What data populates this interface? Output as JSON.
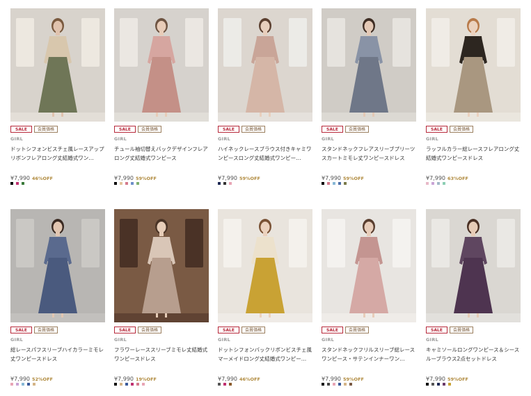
{
  "products": [
    {
      "sale": "SALE",
      "member": "会員価格",
      "brand": "GIRL",
      "title": "ドットシフォンビスチェ風レースアップリボンフレアロング丈結婚式ワン…",
      "price": "¥7,990",
      "discount": "46%OFF",
      "swatches": [
        "#000000",
        "#c0306f",
        "#3a7a3a"
      ],
      "photo": {
        "bg": "#d8d3cc",
        "window": "#ede8e0",
        "dress": "#6f7657",
        "accent": "#d8c7ad",
        "skin": "#e0c3ae",
        "hair": "#7a5a3f"
      }
    },
    {
      "sale": "SALE",
      "member": "会員価格",
      "brand": "GIRL",
      "title": "チュール袖切替えバックデザインフレアロング丈結婚式ワンピース",
      "price": "¥7,990",
      "discount": "59%OFF",
      "swatches": [
        "#000000",
        "#e2c49d",
        "#d47a8c",
        "#6e8fc9",
        "#80b070"
      ],
      "photo": {
        "bg": "#d6d2cd",
        "window": "#ebe7e2",
        "dress": "#c49087",
        "accent": "#d6a6a0",
        "skin": "#e8ccb8",
        "hair": "#6e5442"
      }
    },
    {
      "sale": "SALE",
      "member": "会員価格",
      "brand": "GIRL",
      "title": "ハイネックレースブラウス付きキャミワンピースロング丈結婚式ワンピー…",
      "price": "¥7,990",
      "discount": "59%OFF",
      "swatches": [
        "#1f2a55",
        "#333333",
        "#e8a5b5"
      ],
      "photo": {
        "bg": "#dcd6cf",
        "window": "#ecebe7",
        "dress": "#d5b6a7",
        "accent": "#c9a598",
        "skin": "#e8cfbd",
        "hair": "#5c4030"
      }
    },
    {
      "sale": "SALE",
      "member": "会員価格",
      "brand": "GIRL",
      "title": "スタンドネックフレアスリーブプリーツスカートミモレ丈ワンピースドレス",
      "price": "¥7,990",
      "discount": "59%OFF",
      "swatches": [
        "#000000",
        "#d47a8c",
        "#88b8d6",
        "#4d6fa8",
        "#7a7a4a"
      ],
      "photo": {
        "bg": "#d0ccc6",
        "window": "#e6e3de",
        "dress": "#6f7788",
        "accent": "#8993a6",
        "skin": "#e4c9b6",
        "hair": "#3f2e24"
      }
    },
    {
      "sale": "SALE",
      "member": "会員価格",
      "brand": "GIRL",
      "title": "ラッフルカラー総レースフレアロング丈結婚式ワンピースドレス",
      "price": "¥7,990",
      "discount": "63%OFF",
      "swatches": [
        "#e8b9c8",
        "#c9a4d6",
        "#a2b8c7",
        "#8dcfb4"
      ],
      "photo": {
        "bg": "#e3ddd4",
        "window": "#f0ece6",
        "dress": "#a99780",
        "accent": "#2d2620",
        "skin": "#ebd2bf",
        "hair": "#b87a4a"
      }
    },
    {
      "sale": "SALE",
      "member": "会員価格",
      "brand": "GIRL",
      "title": "総レースパフスリーブハイカラーミモレ丈ワンピースドレス",
      "price": "¥7,990",
      "discount": "52%OFF",
      "swatches": [
        "#e8a5b5",
        "#c9a4d6",
        "#88b8d6",
        "#3a5a9a",
        "#d4b487"
      ],
      "photo": {
        "bg": "#b8b6b3",
        "window": "#cac8c4",
        "dress": "#4a5a7e",
        "accent": "#5a6a8e",
        "skin": "#e2c6b1",
        "hair": "#3a2a22"
      }
    },
    {
      "sale": "SALE",
      "member": "会員価格",
      "brand": "GIRL",
      "title": "フラワーレーススリーブミモレ丈結婚式ワンピースドレス",
      "price": "¥7,990",
      "discount": "19%OFF",
      "swatches": [
        "#000000",
        "#d4b487",
        "#3a5a9a",
        "#c0306f",
        "#d47a8c",
        "#e8a5b5"
      ],
      "photo": {
        "bg": "#7a5a44",
        "window": "#4a3226",
        "dress": "#b79e8e",
        "accent": "#d9c6b7",
        "skin": "#e7cdb8",
        "hair": "#4a3426"
      }
    },
    {
      "sale": "SALE",
      "member": "会員価格",
      "brand": "GIRL",
      "title": "ドットシフォンバックリボンビスチェ風マーメイドロング丈結婚式ワンピー…",
      "price": "¥7,990",
      "discount": "46%OFF",
      "swatches": [
        "#555555",
        "#c0306f",
        "#8a5a2a"
      ],
      "photo": {
        "bg": "#e9e4dd",
        "window": "#f4f1ec",
        "dress": "#c9a234",
        "accent": "#ece1cc",
        "skin": "#ebd2be",
        "hair": "#7a5235"
      }
    },
    {
      "sale": "SALE",
      "member": "会員価格",
      "brand": "GIRL",
      "title": "スタンドネックフリルスリーブ総レースワンピース・サテンインナーワン…",
      "price": "¥7,990",
      "discount": "59%OFF",
      "swatches": [
        "#000000",
        "#444444",
        "#e8a5b5",
        "#3a5a9a",
        "#d4b487",
        "#7a5a44"
      ],
      "photo": {
        "bg": "#e8e5e1",
        "window": "#f4f2ef",
        "dress": "#d5a9a5",
        "accent": "#c49591",
        "skin": "#e8cdba",
        "hair": "#5a3f30"
      }
    },
    {
      "sale": "SALE",
      "member": "会員価格",
      "brand": "GIRL",
      "title": "キャミソールロングワンピース＆シースルーブラウス2点セットドレス",
      "price": "¥7,990",
      "discount": "59%OFF",
      "swatches": [
        "#000000",
        "#555555",
        "#1f2a55",
        "#6a3a6a",
        "#c9a234"
      ],
      "photo": {
        "bg": "#dad7d2",
        "window": "#eae8e4",
        "dress": "#4e3450",
        "accent": "#5f4660",
        "skin": "#e6cbb6",
        "hair": "#4a3024"
      }
    }
  ]
}
